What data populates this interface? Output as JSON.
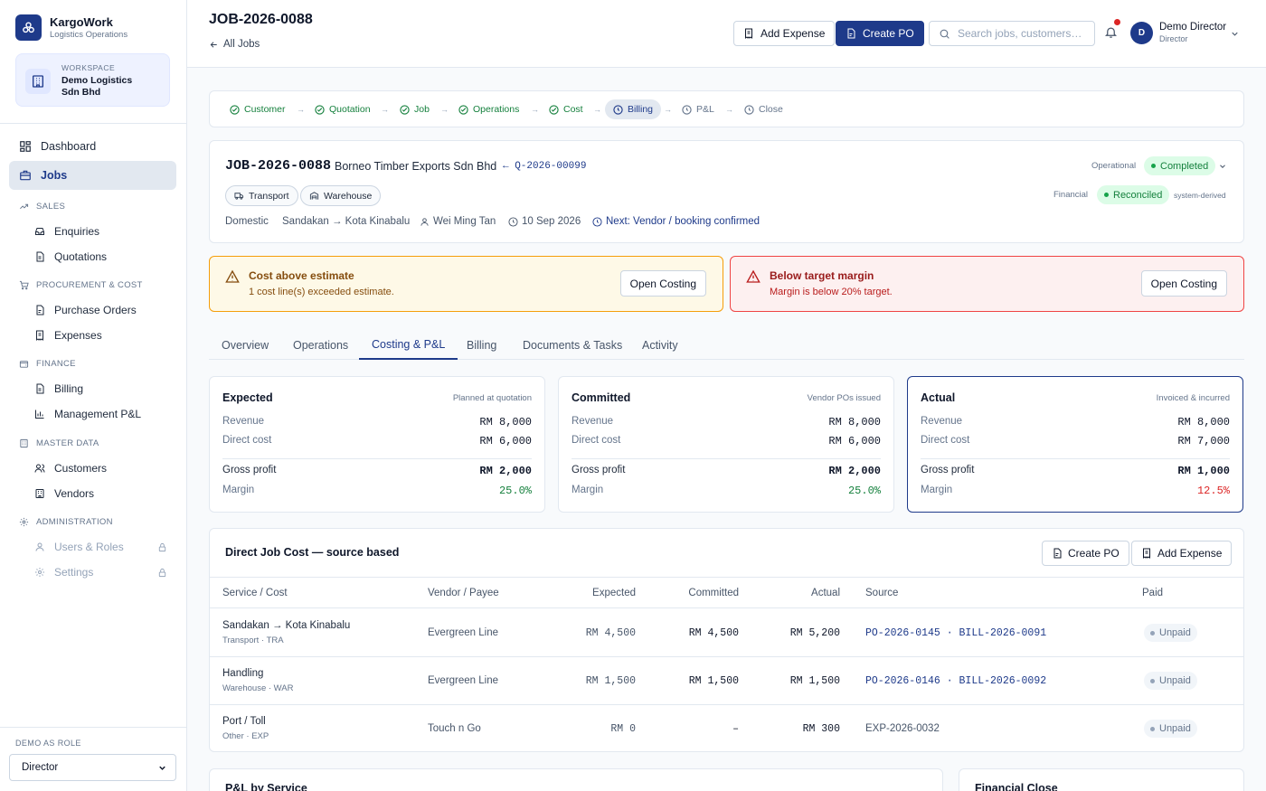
{
  "brand": {
    "name": "KargoWork",
    "subtitle": "Logistics Operations"
  },
  "workspace": {
    "label": "WORKSPACE",
    "name": "Demo Logistics Sdn Bhd"
  },
  "nav": {
    "dashboard": "Dashboard",
    "jobs": "Jobs",
    "sections": {
      "sales": "SALES",
      "procurement": "PROCUREMENT & COST",
      "finance": "FINANCE",
      "master": "MASTER DATA",
      "admin": "ADMINISTRATION"
    },
    "items": {
      "enquiries": "Enquiries",
      "quotations": "Quotations",
      "purchase_orders": "Purchase Orders",
      "expenses": "Expenses",
      "billing": "Billing",
      "management_pl": "Management P&L",
      "customers": "Customers",
      "vendors": "Vendors",
      "users_roles": "Users & Roles",
      "settings": "Settings"
    }
  },
  "role": {
    "label": "DEMO AS ROLE",
    "value": "Director"
  },
  "header": {
    "title": "JOB-2026-0088",
    "back": "All Jobs",
    "add_expense": "Add Expense",
    "create_po": "Create PO",
    "search_placeholder": "Search jobs, customers…",
    "user_initial": "D",
    "user_name": "Demo Director",
    "user_role": "Director"
  },
  "steps": [
    "Customer",
    "Quotation",
    "Job",
    "Operations",
    "Cost",
    "Billing",
    "P&L",
    "Close"
  ],
  "job": {
    "id": "JOB-2026-0088",
    "customer": "Borneo Timber Exports Sdn Bhd",
    "quote_ref": "← Q-2026-00099",
    "pills": [
      "Transport",
      "Warehouse"
    ],
    "type": "Domestic",
    "route": "Sandakan → Kota Kinabalu",
    "owner": "Wei Ming Tan",
    "date": "10 Sep 2026",
    "next": "Next: Vendor / booking confirmed",
    "operational_label": "Operational",
    "operational_status": "Completed",
    "financial_label": "Financial",
    "financial_status": "Reconciled",
    "financial_note": "system-derived"
  },
  "alerts": {
    "cost": {
      "title": "Cost above estimate",
      "desc": "1 cost line(s) exceeded estimate.",
      "button": "Open Costing"
    },
    "margin": {
      "title": "Below target margin",
      "desc": "Margin is below 20% target.",
      "button": "Open Costing"
    }
  },
  "tabs": [
    "Overview",
    "Operations",
    "Costing & P&L",
    "Billing",
    "Documents & Tasks",
    "Activity"
  ],
  "labels": {
    "revenue": "Revenue",
    "direct_cost": "Direct cost",
    "gross_profit": "Gross profit",
    "margin": "Margin"
  },
  "pnl": {
    "expected": {
      "title": "Expected",
      "sub": "Planned at quotation",
      "revenue": "RM 8,000",
      "cost": "RM 6,000",
      "gp": "RM 2,000",
      "margin": "25.0%"
    },
    "committed": {
      "title": "Committed",
      "sub": "Vendor POs issued",
      "revenue": "RM 8,000",
      "cost": "RM 6,000",
      "gp": "RM 2,000",
      "margin": "25.0%"
    },
    "actual": {
      "title": "Actual",
      "sub": "Invoiced & incurred",
      "revenue": "RM 8,000",
      "cost": "RM 7,000",
      "gp": "RM 1,000",
      "margin": "12.5%"
    }
  },
  "direct_cost": {
    "title": "Direct Job Cost — source based",
    "create_po": "Create PO",
    "add_expense": "Add Expense",
    "columns": [
      "Service / Cost",
      "Vendor / Payee",
      "Expected",
      "Committed",
      "Actual",
      "Source",
      "Paid"
    ],
    "rows": [
      {
        "service": "Sandakan → Kota Kinabalu",
        "sub": "Transport · TRA",
        "vendor": "Evergreen Line",
        "expected": "RM 4,500",
        "committed": "RM 4,500",
        "actual": "RM 5,200",
        "source": "PO-2026-0145 · BILL-2026-0091",
        "paid": "Unpaid"
      },
      {
        "service": "Handling",
        "sub": "Warehouse · WAR",
        "vendor": "Evergreen Line",
        "expected": "RM 1,500",
        "committed": "RM 1,500",
        "actual": "RM 1,500",
        "source": "PO-2026-0146 · BILL-2026-0092",
        "paid": "Unpaid"
      },
      {
        "service": "Port / Toll",
        "sub": "Other · EXP",
        "vendor": "Touch n Go",
        "expected": "RM 0",
        "committed": "–",
        "actual": "RM 300",
        "source": "EXP-2026-0032",
        "paid": "Unpaid"
      }
    ]
  },
  "bottom": {
    "pnl_by_service": "P&L by Service",
    "financial_close": "Financial Close"
  },
  "colors": {
    "primary": "#1e3a8a",
    "success": "#15803d",
    "danger": "#dc2626",
    "warning": "#f59e0b"
  }
}
